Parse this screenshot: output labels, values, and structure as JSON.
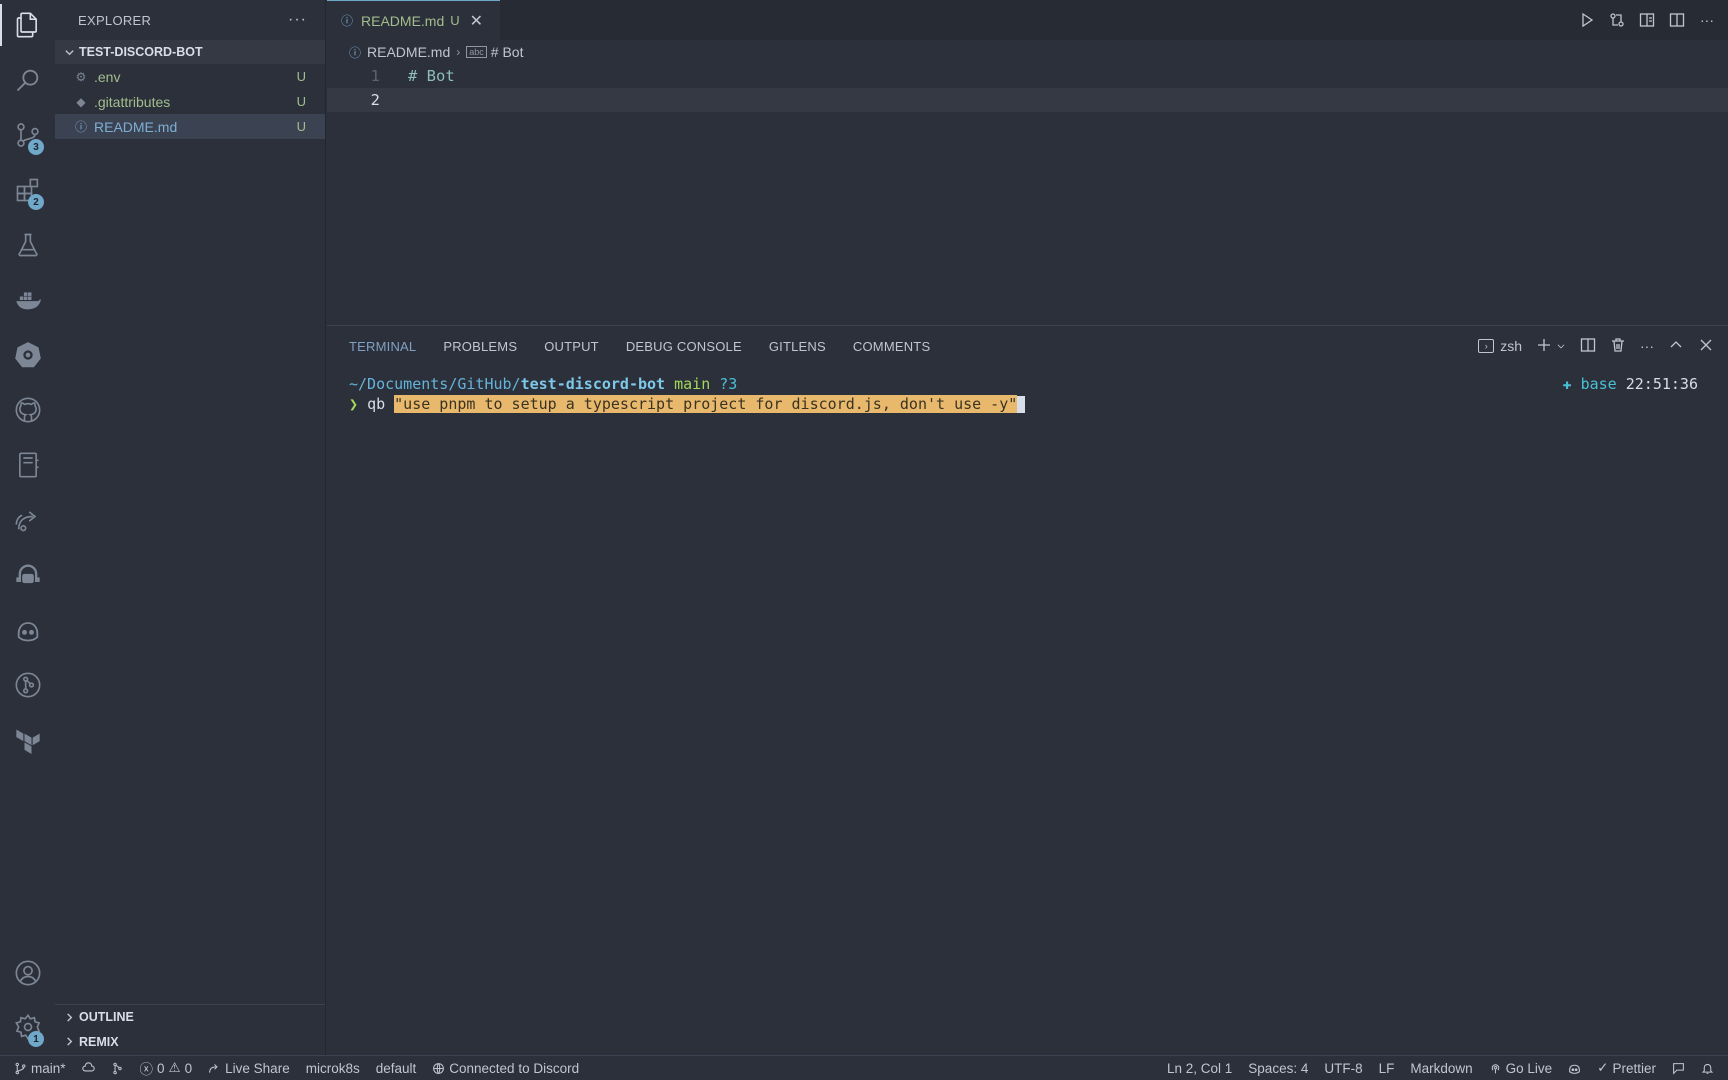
{
  "activity_bar": {
    "items": [
      {
        "name": "explorer-icon",
        "active": true
      },
      {
        "name": "search-icon"
      },
      {
        "name": "source-control-icon",
        "badge": "3"
      },
      {
        "name": "extensions-icon",
        "badge": "2"
      },
      {
        "name": "testing-icon"
      },
      {
        "name": "docker-icon"
      },
      {
        "name": "kubernetes-icon"
      },
      {
        "name": "github-icon"
      },
      {
        "name": "notebook-icon"
      },
      {
        "name": "live-share-icon"
      },
      {
        "name": "remote-explorer-icon"
      },
      {
        "name": "copilot-icon"
      },
      {
        "name": "gitlens-icon"
      },
      {
        "name": "terraform-icon"
      }
    ],
    "accounts_icon": "account-icon",
    "settings_badge": "1"
  },
  "sidebar": {
    "title": "EXPLORER",
    "more": "···",
    "folder": "TEST-DISCORD-BOT",
    "files": [
      {
        "icon": "gear-icon",
        "name": ".env",
        "status": "U"
      },
      {
        "icon": "diamond-icon",
        "name": ".gitattributes",
        "status": "U"
      },
      {
        "icon": "info-icon",
        "name": "README.md",
        "status": "U"
      }
    ],
    "outline_label": "OUTLINE",
    "remix_label": "REMIX"
  },
  "editor": {
    "tab": {
      "name": "README.md",
      "status": "U",
      "close": "✕"
    },
    "breadcrumb": {
      "file": "README.md",
      "symbol": "# Bot"
    },
    "lines": [
      {
        "number": "1",
        "text": "# Bot"
      },
      {
        "number": "2",
        "text": ""
      }
    ]
  },
  "panel": {
    "tabs": [
      "TERMINAL",
      "PROBLEMS",
      "OUTPUT",
      "DEBUG CONSOLE",
      "GITLENS",
      "COMMENTS"
    ],
    "shell": "zsh",
    "terminal": {
      "path_prefix": "~/Documents/GitHub/",
      "path_dir": "test-discord-bot",
      "branch": "main",
      "untracked": "?3",
      "env": "base",
      "time": "22:51:36",
      "prompt": "❯",
      "command": "qb",
      "argument": "\"use pnpm to setup a typescript project for discord.js, don't use -y\""
    }
  },
  "status_bar": {
    "branch": "main*",
    "errors": "0",
    "warnings": "0",
    "live_share": "Live Share",
    "kube_cluster": "microk8s",
    "kube_namespace": "default",
    "discord": "Connected to Discord",
    "cursor": "Ln 2, Col 1",
    "spaces": "Spaces: 4",
    "encoding": "UTF-8",
    "eol": "LF",
    "language": "Markdown",
    "go_live": "Go Live",
    "prettier": "Prettier"
  }
}
